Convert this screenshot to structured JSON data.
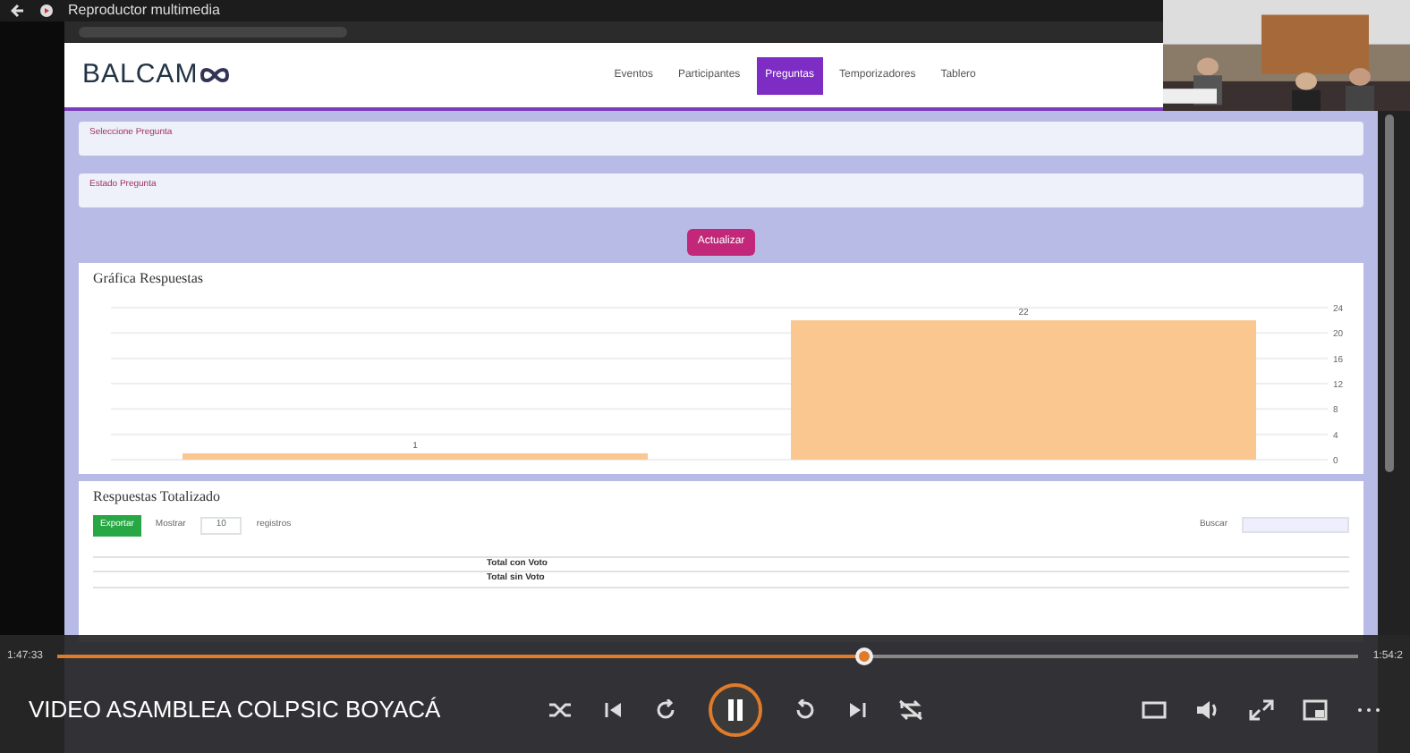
{
  "window": {
    "title": "Reproductor multimedia"
  },
  "page": {
    "logo": "BALCAM",
    "tabs": [
      {
        "label": "Eventos",
        "selected": false
      },
      {
        "label": "Participantes",
        "selected": false
      },
      {
        "label": "Preguntas",
        "selected": true
      },
      {
        "label": "Temporizadores",
        "selected": false
      },
      {
        "label": "Tablero",
        "selected": false
      }
    ],
    "selects": [
      {
        "label": "Seleccione Pregunta"
      },
      {
        "label": "Estado Pregunta"
      }
    ],
    "refresh_button": "Actualizar",
    "chart": {
      "title": "Gráfica Respuestas",
      "chart_data": {
        "type": "bar",
        "categories": [
          null,
          null
        ],
        "values": [
          1,
          22
        ],
        "ylim": [
          0,
          24
        ],
        "yticks": [
          0,
          4,
          8,
          12,
          16,
          20,
          24
        ],
        "grid": true,
        "data_labels": true
      }
    },
    "table": {
      "title": "Respuestas Totalizado",
      "export_button": "Exportar",
      "show_label": "Mostrar",
      "page_size": "10",
      "records_label": "registros",
      "search_label": "Buscar",
      "totals": [
        {
          "label": "Total con Voto"
        },
        {
          "label": "Total sin Voto"
        }
      ]
    }
  },
  "player": {
    "elapsed": "1:47:33",
    "remaining": "1:54:2",
    "level": 0.62,
    "title": "VIDEO ASAMBLEA COLPSIC BOYACÁ",
    "playing": true
  }
}
